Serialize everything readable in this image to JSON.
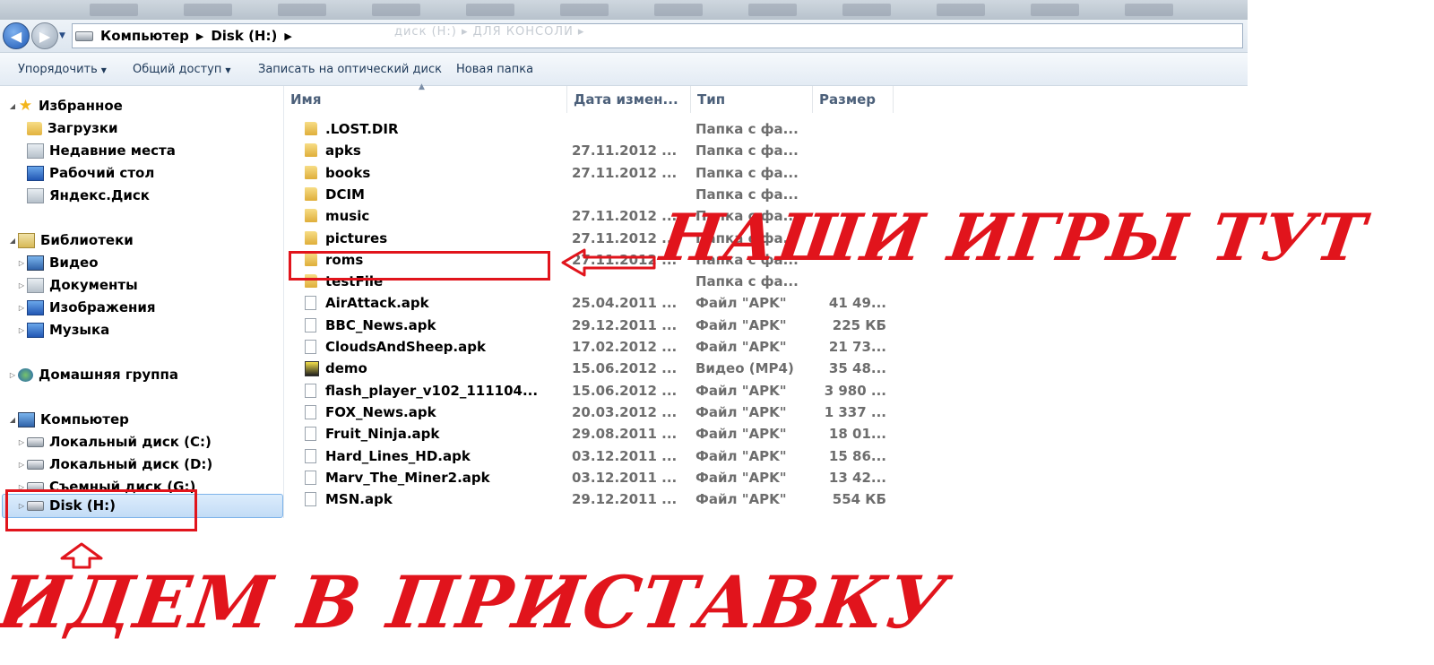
{
  "address_bar": {
    "crumbs": [
      "Компьютер",
      "Disk (H:)"
    ],
    "ghost_path": "диск (H:) ▸ ДЛЯ КОНСОЛИ ▸"
  },
  "toolbar": {
    "organize": "Упорядочить",
    "share": "Общий доступ",
    "burn": "Записать на оптический диск",
    "new_folder": "Новая папка"
  },
  "nav": {
    "favorites": "Избранное",
    "downloads": "Загрузки",
    "recent": "Недавние места",
    "desktop": "Рабочий стол",
    "yandex": "Яндекс.Диск",
    "libraries": "Библиотеки",
    "video": "Видео",
    "documents": "Документы",
    "images": "Изображения",
    "music": "Музыка",
    "homegroup": "Домашняя группа",
    "computer": "Компьютер",
    "disk_c": "Локальный диск (C:)",
    "disk_d": "Локальный диск (D:)",
    "disk_g": "Съемный диск (G:)",
    "disk_h": "Disk (H:)"
  },
  "columns": {
    "name": "Имя",
    "date": "Дата измен...",
    "type": "Тип",
    "size": "Размер"
  },
  "files": [
    {
      "name": ".LOST.DIR",
      "date": "",
      "type": "Папка с фа...",
      "size": "",
      "kind": "folder"
    },
    {
      "name": "apks",
      "date": "27.11.2012 ...",
      "type": "Папка с фа...",
      "size": "",
      "kind": "folder"
    },
    {
      "name": "books",
      "date": "27.11.2012 ...",
      "type": "Папка с фа...",
      "size": "",
      "kind": "folder"
    },
    {
      "name": "DCIM",
      "date": "",
      "type": "Папка с фа...",
      "size": "",
      "kind": "folder"
    },
    {
      "name": "music",
      "date": "27.11.2012 ...",
      "type": "Папка с фа...",
      "size": "",
      "kind": "folder"
    },
    {
      "name": "pictures",
      "date": "27.11.2012 ...",
      "type": "Папка с фа...",
      "size": "",
      "kind": "folder"
    },
    {
      "name": "roms",
      "date": "27.11.2012 ...",
      "type": "Папка с фа...",
      "size": "",
      "kind": "folder"
    },
    {
      "name": "testFile",
      "date": "",
      "type": "Папка с фа...",
      "size": "",
      "kind": "folder"
    },
    {
      "name": "AirAttack.apk",
      "date": "25.04.2011 ...",
      "type": "Файл \"APK\"",
      "size": "41 49...",
      "kind": "file"
    },
    {
      "name": "BBC_News.apk",
      "date": "29.12.2011 ...",
      "type": "Файл \"APK\"",
      "size": "225 КБ",
      "kind": "file"
    },
    {
      "name": "CloudsAndSheep.apk",
      "date": "17.02.2012 ...",
      "type": "Файл \"APK\"",
      "size": "21 73...",
      "kind": "file"
    },
    {
      "name": "demo",
      "date": "15.06.2012 ...",
      "type": "Видео (MP4)",
      "size": "35 48...",
      "kind": "video"
    },
    {
      "name": "flash_player_v102_111104...",
      "date": "15.06.2012 ...",
      "type": "Файл \"APK\"",
      "size": "3 980 ...",
      "kind": "file"
    },
    {
      "name": "FOX_News.apk",
      "date": "20.03.2012 ...",
      "type": "Файл \"APK\"",
      "size": "1 337 ...",
      "kind": "file"
    },
    {
      "name": "Fruit_Ninja.apk",
      "date": "29.08.2011 ...",
      "type": "Файл \"APK\"",
      "size": "18 01...",
      "kind": "file"
    },
    {
      "name": "Hard_Lines_HD.apk",
      "date": "03.12.2011 ...",
      "type": "Файл \"APK\"",
      "size": "15 86...",
      "kind": "file"
    },
    {
      "name": "Marv_The_Miner2.apk",
      "date": "03.12.2011 ...",
      "type": "Файл \"APK\"",
      "size": "13 42...",
      "kind": "file"
    },
    {
      "name": "MSN.apk",
      "date": "29.12.2011 ...",
      "type": "Файл \"APK\"",
      "size": "554 КБ",
      "kind": "file"
    }
  ],
  "annotations": {
    "games_here": "НАШИ ИГРЫ ТУТ",
    "go_console": "ИДЕМ В ПРИСТАВКУ"
  },
  "colors": {
    "annotation_red": "#e1141c",
    "selection_blue": "#c2dcf6"
  }
}
